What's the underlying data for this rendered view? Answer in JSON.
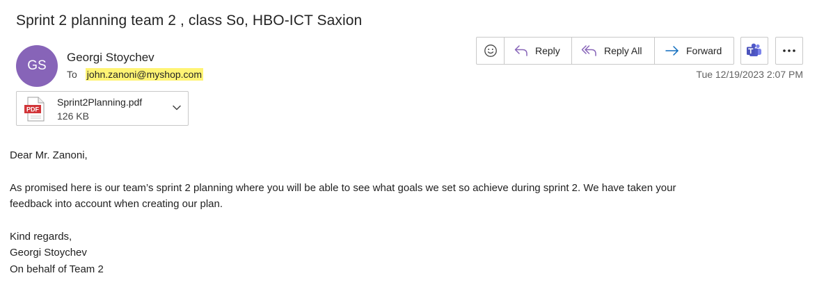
{
  "email": {
    "subject": "Sprint 2 planning team 2 , class So, HBO-ICT Saxion",
    "sender": {
      "initials": "GS",
      "name": "Georgi Stoychev",
      "avatar_color": "#8764b8"
    },
    "to_label": "To",
    "recipient": "john.zanoni@myshop.com",
    "recipient_highlight": "#fff474",
    "timestamp": "Tue 12/19/2023 2:07 PM"
  },
  "toolbar": {
    "emoji_icon": "emoji-icon",
    "reply_label": "Reply",
    "reply_all_label": "Reply All",
    "forward_label": "Forward",
    "teams_icon": "teams-icon",
    "more_icon": "more-icon",
    "accent_reply": "#8764b8",
    "accent_forward": "#0f6cbd"
  },
  "attachment": {
    "icon": "pdf-icon",
    "name": "Sprint2Planning.pdf",
    "size": "126 KB"
  },
  "body": {
    "greeting": "Dear Mr. Zanoni,",
    "paragraph_line1": "As promised here is our team’s sprint 2 planning where you will be able to see what goals we set so achieve during sprint 2. We have taken your",
    "paragraph_line2": "feedback into account when creating our plan.",
    "closing": "Kind regards,",
    "signature_name": "Georgi Stoychev",
    "signature_team": "On behalf of Team 2"
  }
}
